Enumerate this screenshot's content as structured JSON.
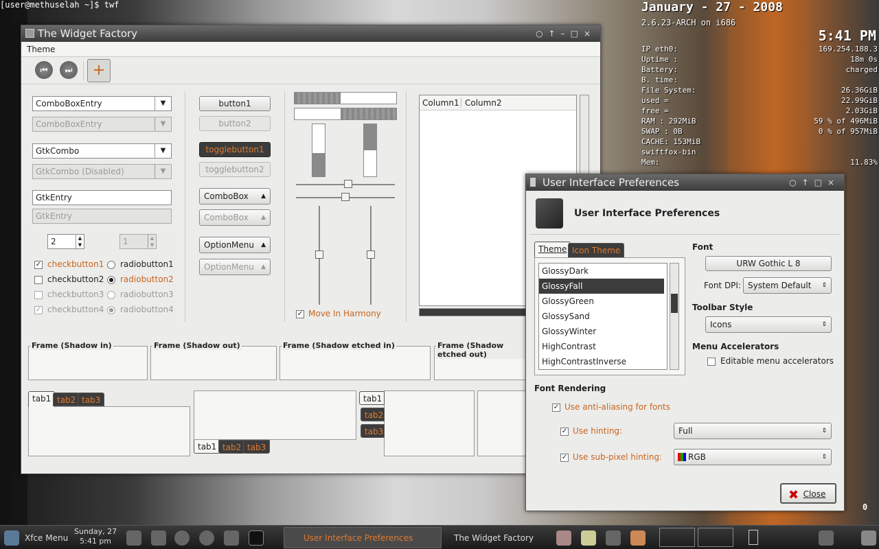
{
  "terminal": {
    "line1": "[user@methuselah ~]$ twf"
  },
  "conky": {
    "date": "January - 27 - 2008",
    "kernel": "2.6.23-ARCH on i686",
    "clock": "5:41 PM",
    "rows": [
      {
        "k": "IP  eth0:",
        "v": "169.254.188.3"
      },
      {
        "k": "    Uptime :",
        "v": "18m 0s"
      },
      {
        "k": "    Battery:",
        "v": "charged"
      },
      {
        "k": "    B. time:",
        "v": ""
      },
      {
        "k": "File System:",
        "v": "26.36GiB"
      },
      {
        "k": "    used =",
        "v": "22.99GiB"
      },
      {
        "k": "    free =",
        "v": "2.03GiB"
      },
      {
        "k": "RAM  : 292MiB",
        "v": "59 % of 496MiB"
      },
      {
        "k": "SWAP : 0B",
        "v": "0  % of 957MiB"
      },
      {
        "k": "CACHE: 153MiB",
        "v": ""
      },
      {
        "k": "           swiftfox-bin",
        "v": ""
      },
      {
        "k": "             Mem:",
        "v": "11.83%"
      }
    ]
  },
  "twf": {
    "title": "The Widget Factory",
    "menu": "Theme",
    "combo_entry": "ComboBoxEntry",
    "combo_entry_dis": "ComboBoxEntry",
    "gtkcombo": "GtkCombo",
    "gtkcombo_dis": "GtkCombo (Disabled)",
    "entry": "GtkEntry",
    "entry_dis": "GtkEntry",
    "spin1": "2",
    "spin2": "1",
    "check1": "checkbutton1",
    "check2": "checkbutton2",
    "check3": "checkbutton3",
    "check4": "checkbutton4",
    "radio1": "radiobutton1",
    "radio2": "radiobutton2",
    "radio3": "radiobutton3",
    "radio4": "radiobutton4",
    "button1": "button1",
    "button2": "button2",
    "toggle1": "togglebutton1",
    "toggle2": "togglebutton2",
    "combobox": "ComboBox",
    "combobox_dis": "ComboBox",
    "optionmenu": "OptionMenu",
    "optionmenu_dis": "OptionMenu",
    "harmony": "Move In Harmony",
    "col1": "Column1",
    "col2": "Column2",
    "frames": [
      "Frame (Shadow in)",
      "Frame (Shadow out)",
      "Frame (Shadow etched in)",
      "Frame (Shadow etched out)"
    ],
    "tabs": [
      "tab1",
      "tab2",
      "tab3"
    ],
    "progress": [
      0.45,
      0.55
    ],
    "vprogress": [
      0.45,
      0.5
    ]
  },
  "uip": {
    "title": "User Interface Preferences",
    "header": "User Interface Preferences",
    "tab_theme": "Theme",
    "tab_icon": "Icon Theme",
    "themes": [
      "GlossyDark",
      "GlossyFall",
      "GlossyGreen",
      "GlossySand",
      "GlossyWinter",
      "HighContrast",
      "HighContrastInverse"
    ],
    "selected_index": 1,
    "font_section": "Font",
    "font_button": "URW Gothic L 8",
    "font_dpi_label": "Font DPI:",
    "font_dpi": "System Default",
    "toolbar_section": "Toolbar Style",
    "toolbar_style": "Icons",
    "accel_section": "Menu Accelerators",
    "accel_label": "Editable menu accelerators",
    "render_section": "Font Rendering",
    "antialias": "Use anti-aliasing for fonts",
    "hinting_label": "Use hinting:",
    "hinting": "Full",
    "subpixel_label": "Use sub-pixel hinting:",
    "subpixel": "RGB",
    "close": "Close"
  },
  "taskbar": {
    "menu": "Xfce Menu",
    "date": "Sunday, 27",
    "time": "5:41 pm",
    "task1": "User Interface Preferences",
    "task2": "The Widget Factory",
    "tray_num": "0"
  }
}
